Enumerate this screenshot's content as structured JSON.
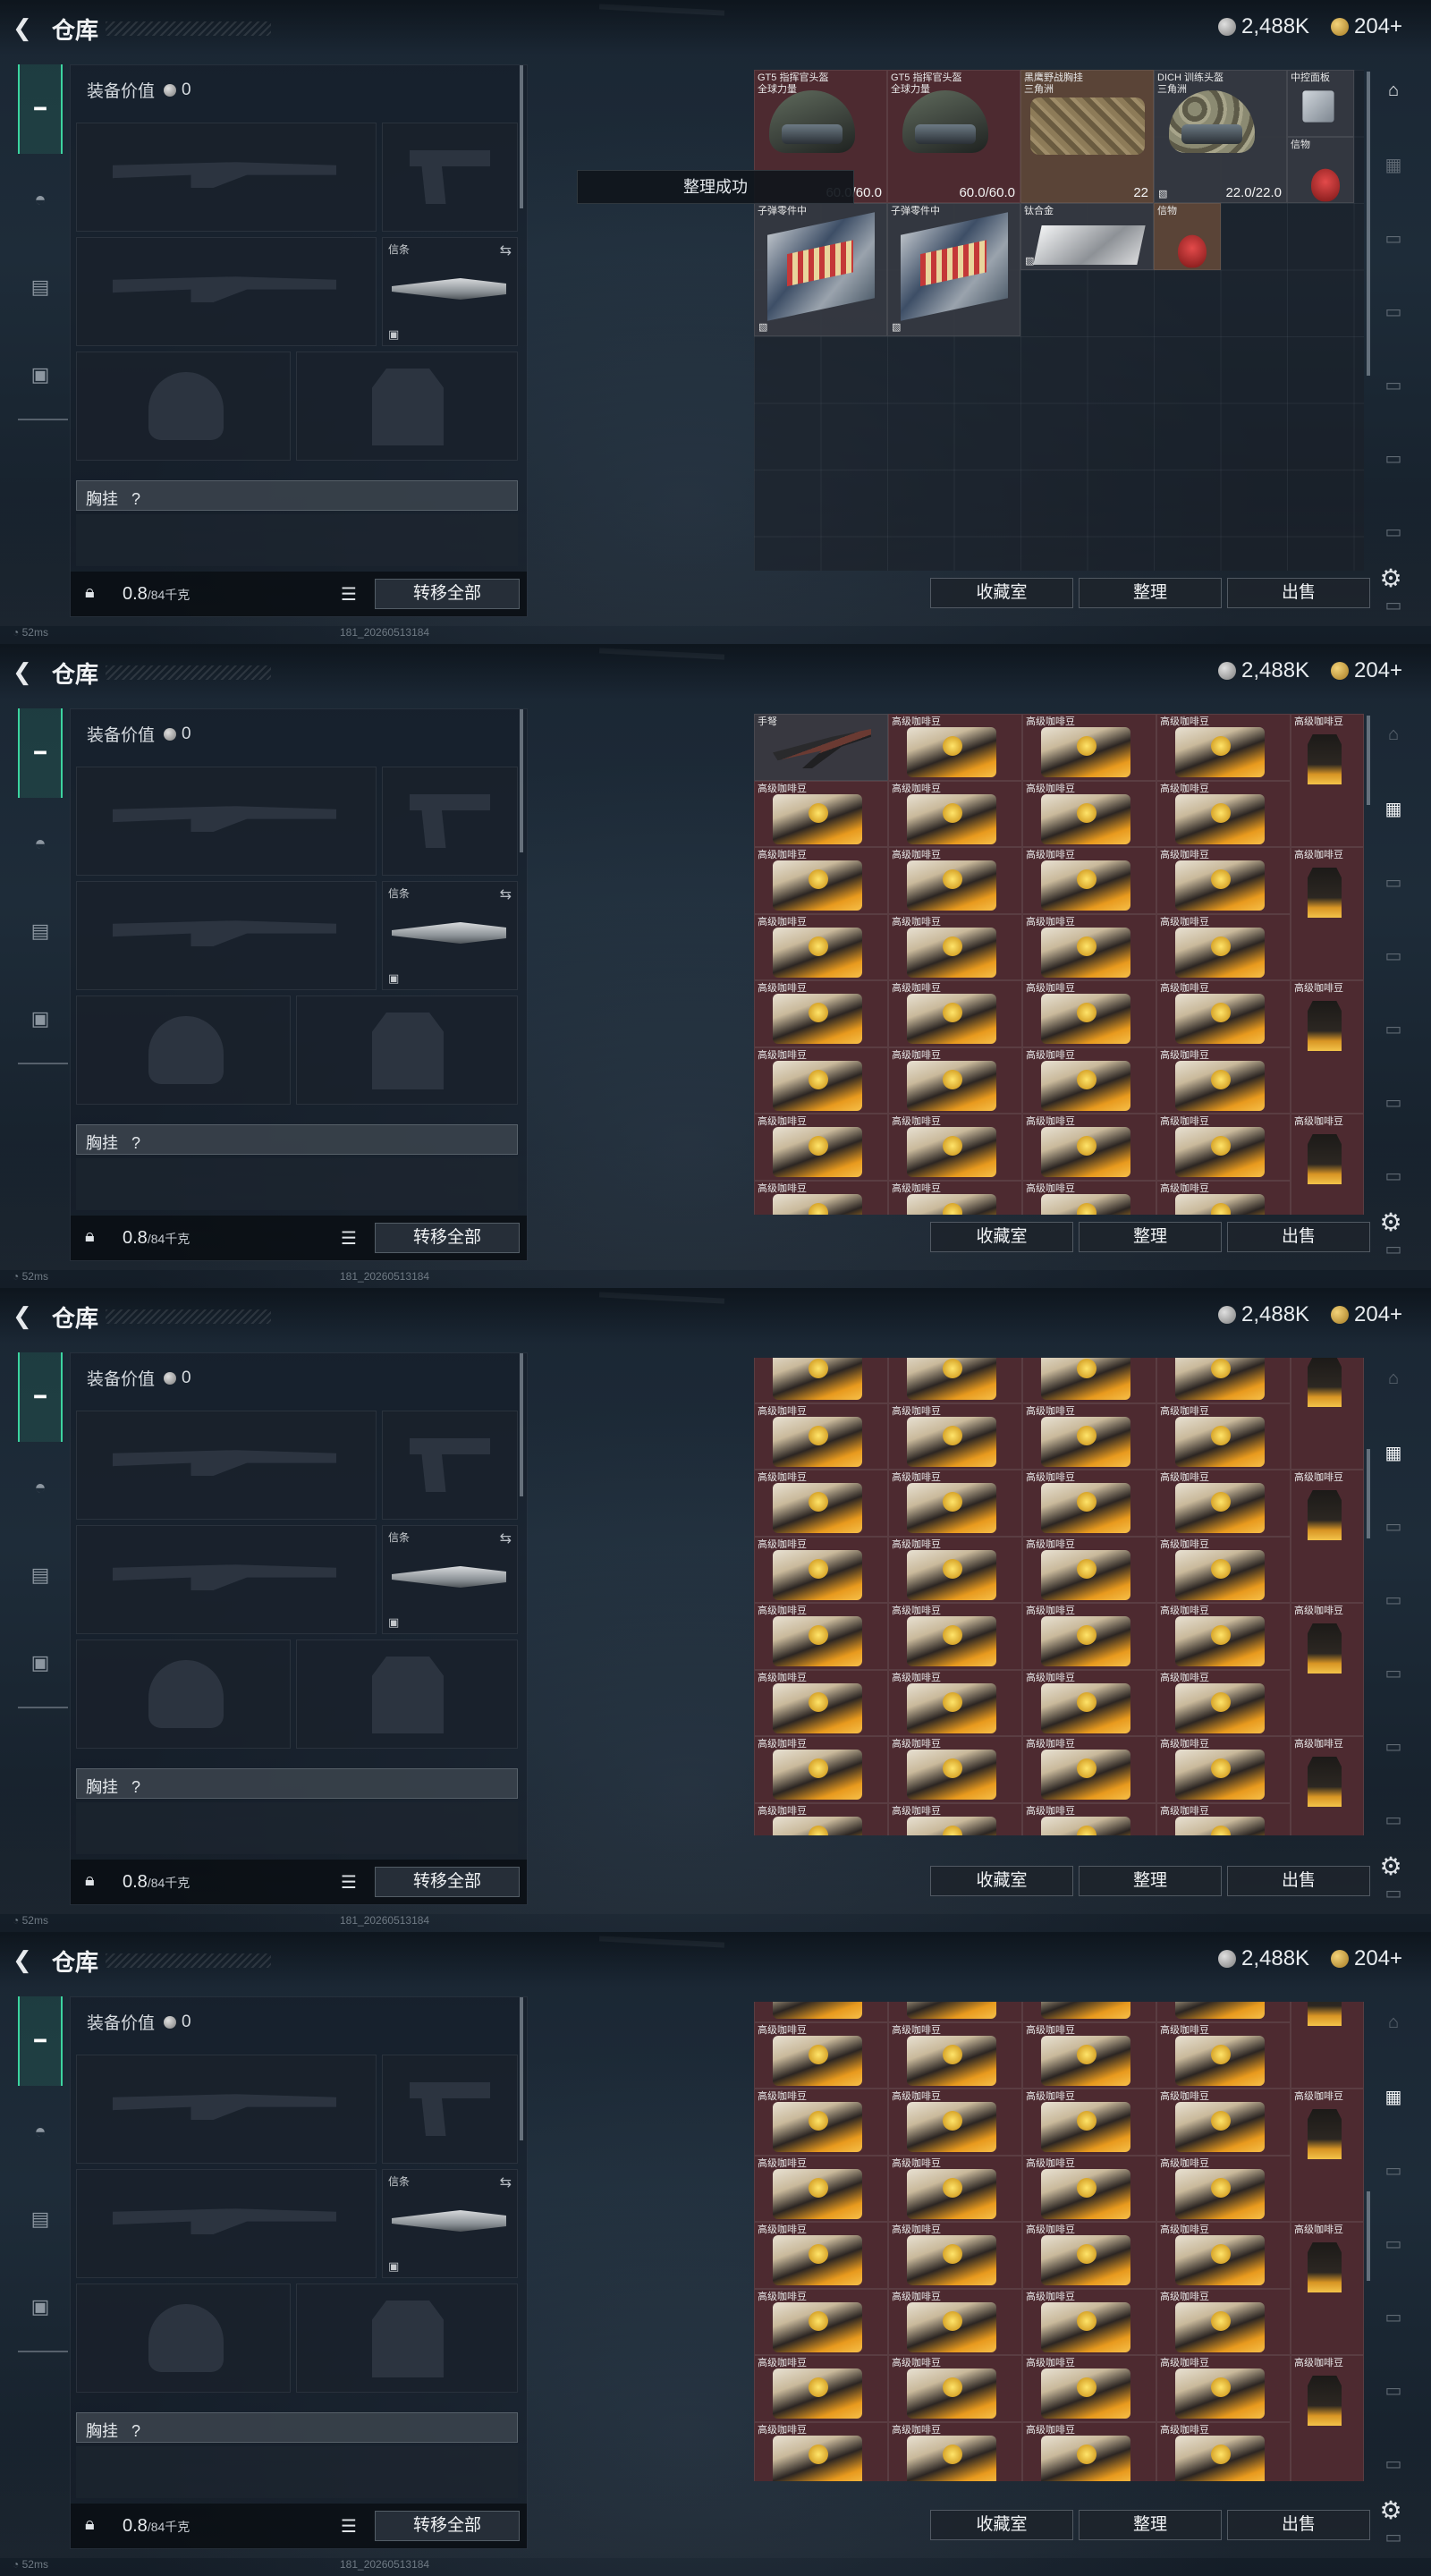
{
  "frames": [
    {
      "storage_mode": "gear",
      "toast": "整理成功"
    },
    {
      "storage_mode": "coffee_top"
    },
    {
      "storage_mode": "coffee_mid"
    },
    {
      "storage_mode": "coffee_low"
    }
  ],
  "header": {
    "title": "仓库",
    "currencies": [
      {
        "icon": "silver-coin-icon",
        "value": "2,488K"
      },
      {
        "icon": "gold-coin-icon",
        "value": "204+"
      }
    ]
  },
  "left_rail": {
    "items": [
      "gun-icon",
      "helmet-icon",
      "backpack-icon",
      "briefcase-icon"
    ]
  },
  "equipment": {
    "value_label": "装备价值",
    "value": "0",
    "melee_slot_label": "信条",
    "chest_rig_label": "胸挂",
    "chest_rig_hint": "?",
    "weight": "0.8",
    "weight_max": "/84千克",
    "transfer_all": "转移全部"
  },
  "status_bar": {
    "ping": "52ms",
    "build": "181_20260513184"
  },
  "storage": {
    "gear_items": [
      {
        "name": "GT5 指挥官头盔",
        "sub": "全球力量",
        "value": "60.0/60.0",
        "style": "red",
        "pic": "helmet"
      },
      {
        "name": "GT5 指挥官头盔",
        "sub": "全球力量",
        "value": "60.0/60.0",
        "style": "red",
        "pic": "helmet"
      },
      {
        "name": "黑鹰野战胸挂",
        "sub": "三角洲",
        "value": "22",
        "style": "gold",
        "pic": "vest"
      },
      {
        "name": "DICH 训练头盔",
        "sub": "三角洲",
        "value": "22.0/22.0",
        "style": "normal",
        "pic": "helmet-camo"
      },
      {
        "name": "中控面板",
        "sub": "",
        "value": "",
        "style": "normal",
        "pic": "phone"
      },
      {
        "name": "信物",
        "sub": "",
        "value": "",
        "style": "normal",
        "pic": "mask"
      },
      {
        "name": "子弹零件中",
        "sub": "",
        "value": "",
        "style": "normal",
        "pic": "ammo"
      },
      {
        "name": "子弹零件中",
        "sub": "",
        "value": "",
        "style": "normal",
        "pic": "ammo"
      },
      {
        "name": "钛合金",
        "sub": "",
        "value": "",
        "style": "normal",
        "pic": "plate"
      },
      {
        "name": "信物",
        "sub": "",
        "value": "",
        "style": "gold",
        "pic": "mask"
      }
    ],
    "crossbow_name": "手弩",
    "coffee_name": "高级咖啡豆"
  },
  "buttons": {
    "collection": "收藏室",
    "sort": "整理",
    "sell": "出售"
  },
  "right_rail": {
    "items": [
      "shelter-icon",
      "storage-cabinet-icon",
      "tab-icon-3",
      "tab-icon-4",
      "tab-icon-5",
      "tab-icon-6",
      "tab-icon-7",
      "tab-icon-8"
    ]
  }
}
